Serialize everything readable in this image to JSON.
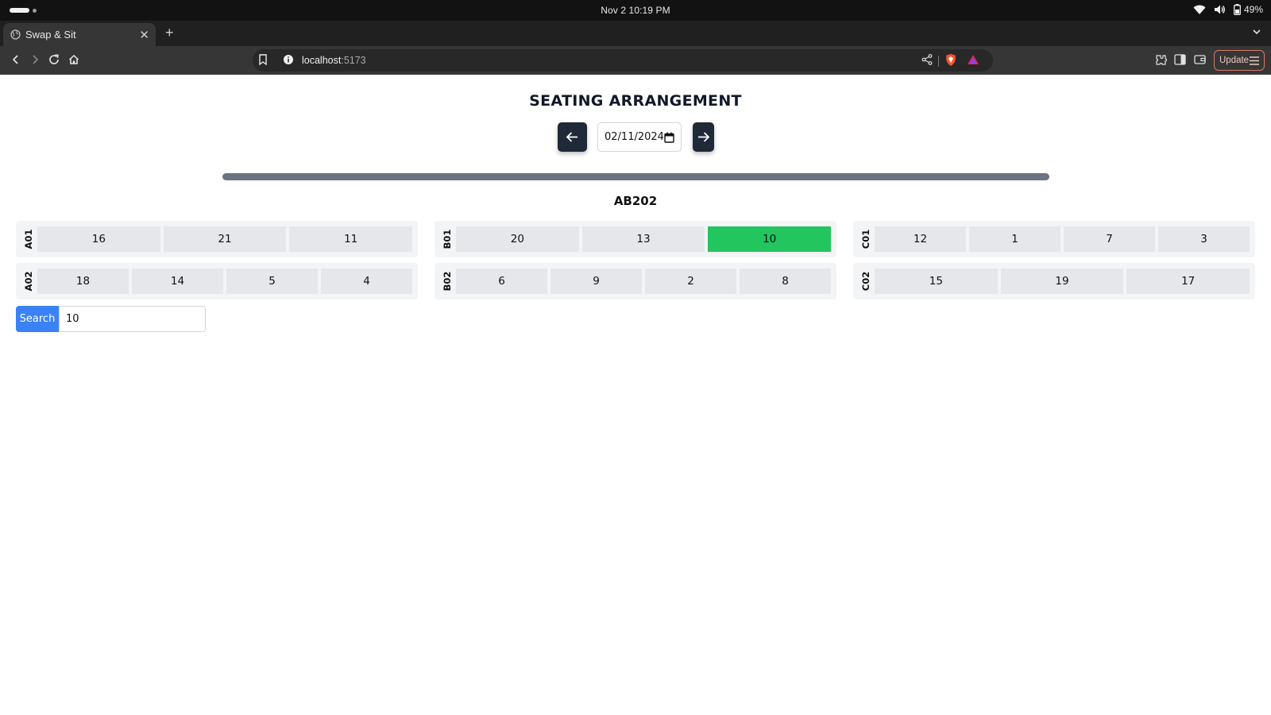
{
  "system_bar": {
    "clock": "Nov 2  10:19 PM",
    "battery": "49%"
  },
  "browser": {
    "tab_title": "Swap & Sit",
    "tab_close": "✕",
    "new_tab": "+",
    "url_host": "localhost",
    "url_port": ":5173",
    "update_label": "Update"
  },
  "page": {
    "title": "SEATING ARRANGEMENT",
    "date_value": "02/11/2024",
    "room": "AB202",
    "highlight_color": "#22c55e",
    "rows": [
      {
        "label": "A01",
        "seats": [
          "16",
          "21",
          "11"
        ]
      },
      {
        "label": "B01",
        "seats": [
          "20",
          "13",
          "10"
        ],
        "highlighted_seat": "10"
      },
      {
        "label": "C01",
        "seats": [
          "12",
          "1",
          "7",
          "3"
        ]
      },
      {
        "label": "A02",
        "seats": [
          "18",
          "14",
          "5",
          "4"
        ]
      },
      {
        "label": "B02",
        "seats": [
          "6",
          "9",
          "2",
          "8"
        ]
      },
      {
        "label": "C02",
        "seats": [
          "15",
          "19",
          "17"
        ]
      }
    ],
    "search": {
      "button_label": "Search",
      "value": "10"
    }
  }
}
